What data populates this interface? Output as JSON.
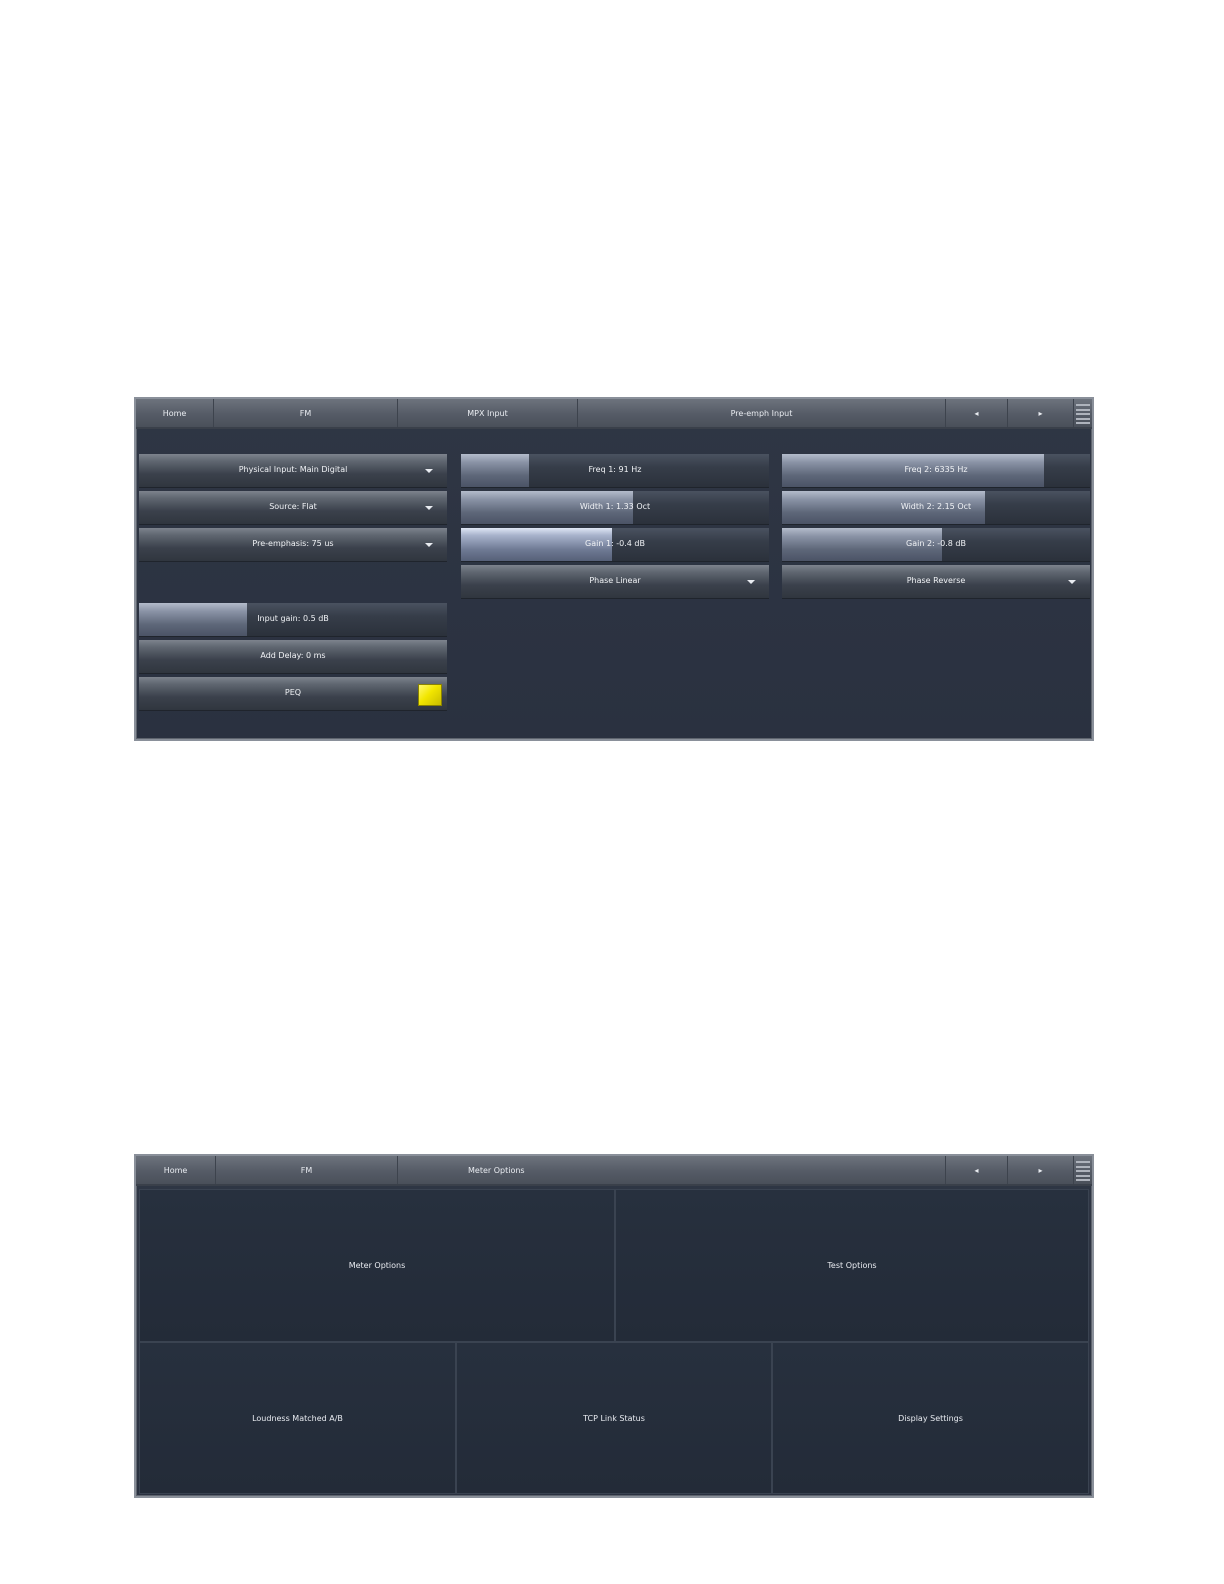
{
  "panel1": {
    "nav": {
      "home": "Home",
      "fm": "FM",
      "mpx": "MPX Input",
      "preemph": "Pre-emph Input",
      "prev": "◂",
      "next": "▸"
    },
    "left": {
      "physical_input": "Physical Input: Main Digital",
      "source": "Source: Flat",
      "preemphasis": "Pre-emphasis: 75 us",
      "input_gain": {
        "label": "Input gain: 0.5 dB",
        "level": 0.35
      },
      "add_delay": "Add Delay: 0 ms",
      "peq": {
        "label": "PEQ",
        "enabled": true,
        "color": "#f2e600"
      }
    },
    "band1": {
      "freq": {
        "label": "Freq 1: 91 Hz",
        "level": 0.22
      },
      "width": {
        "label": "Width 1: 1.33 Oct",
        "level": 0.56
      },
      "gain": {
        "label": "Gain 1: -0.4 dB",
        "level": 0.49
      },
      "phase": "Phase Linear"
    },
    "band2": {
      "freq": {
        "label": "Freq 2: 6335 Hz",
        "level": 0.85
      },
      "width": {
        "label": "Width 2: 2.15 Oct",
        "level": 0.66
      },
      "gain": {
        "label": "Gain 2: -0.8 dB",
        "level": 0.52
      },
      "phase": "Phase Reverse"
    }
  },
  "panel2": {
    "nav": {
      "home": "Home",
      "fm": "FM",
      "meter": "Meter Options",
      "prev": "◂",
      "next": "▸"
    },
    "tiles": {
      "meter_options": "Meter Options",
      "test_options": "Test Options",
      "loudness": "Loudness Matched A/B",
      "tcp": "TCP Link Status",
      "display": "Display Settings"
    }
  }
}
